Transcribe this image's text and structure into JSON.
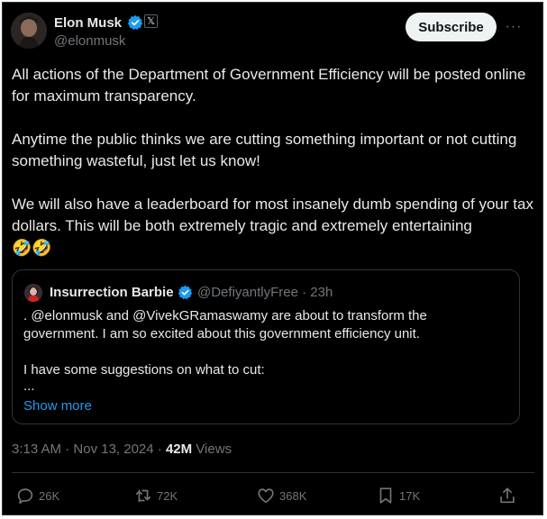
{
  "author": {
    "name": "Elon Musk",
    "handle": "@elonmusk",
    "x_badge": "𝕏"
  },
  "subscribe_label": "Subscribe",
  "more_label": "···",
  "post": {
    "paragraphs": [
      "All actions of the Department of Government Efficiency will be posted online for maximum transparency.",
      "Anytime the public thinks we are cutting something important or not cutting something wasteful, just let us know!",
      "We will also have a leaderboard for most insanely dumb spending of your tax dollars. This will be both extremely tragic and extremely entertaining"
    ],
    "emojis": "🤣🤣"
  },
  "quote": {
    "name": "Insurrection Barbie",
    "handle": "@DefiyantlyFree",
    "separator": "·",
    "time": "23h",
    "lines": [
      ". @elonmusk and @VivekGRamaswamy are about to transform the",
      "government. I am so excited about this government efficiency unit.",
      "",
      "I have some suggestions on what to cut:",
      "..."
    ],
    "show_more": "Show more"
  },
  "meta": {
    "time": "3:13 AM",
    "separator": "·",
    "date": "Nov 13, 2024",
    "views_count": "42M",
    "views_label": "Views"
  },
  "actions": {
    "replies": "26K",
    "reposts": "72K",
    "likes": "368K",
    "bookmarks": "17K"
  },
  "colors": {
    "background": "#000000",
    "text": "#e7e9ea",
    "muted": "#71767b",
    "accent": "#1d9bf0",
    "border": "#2f3336"
  }
}
